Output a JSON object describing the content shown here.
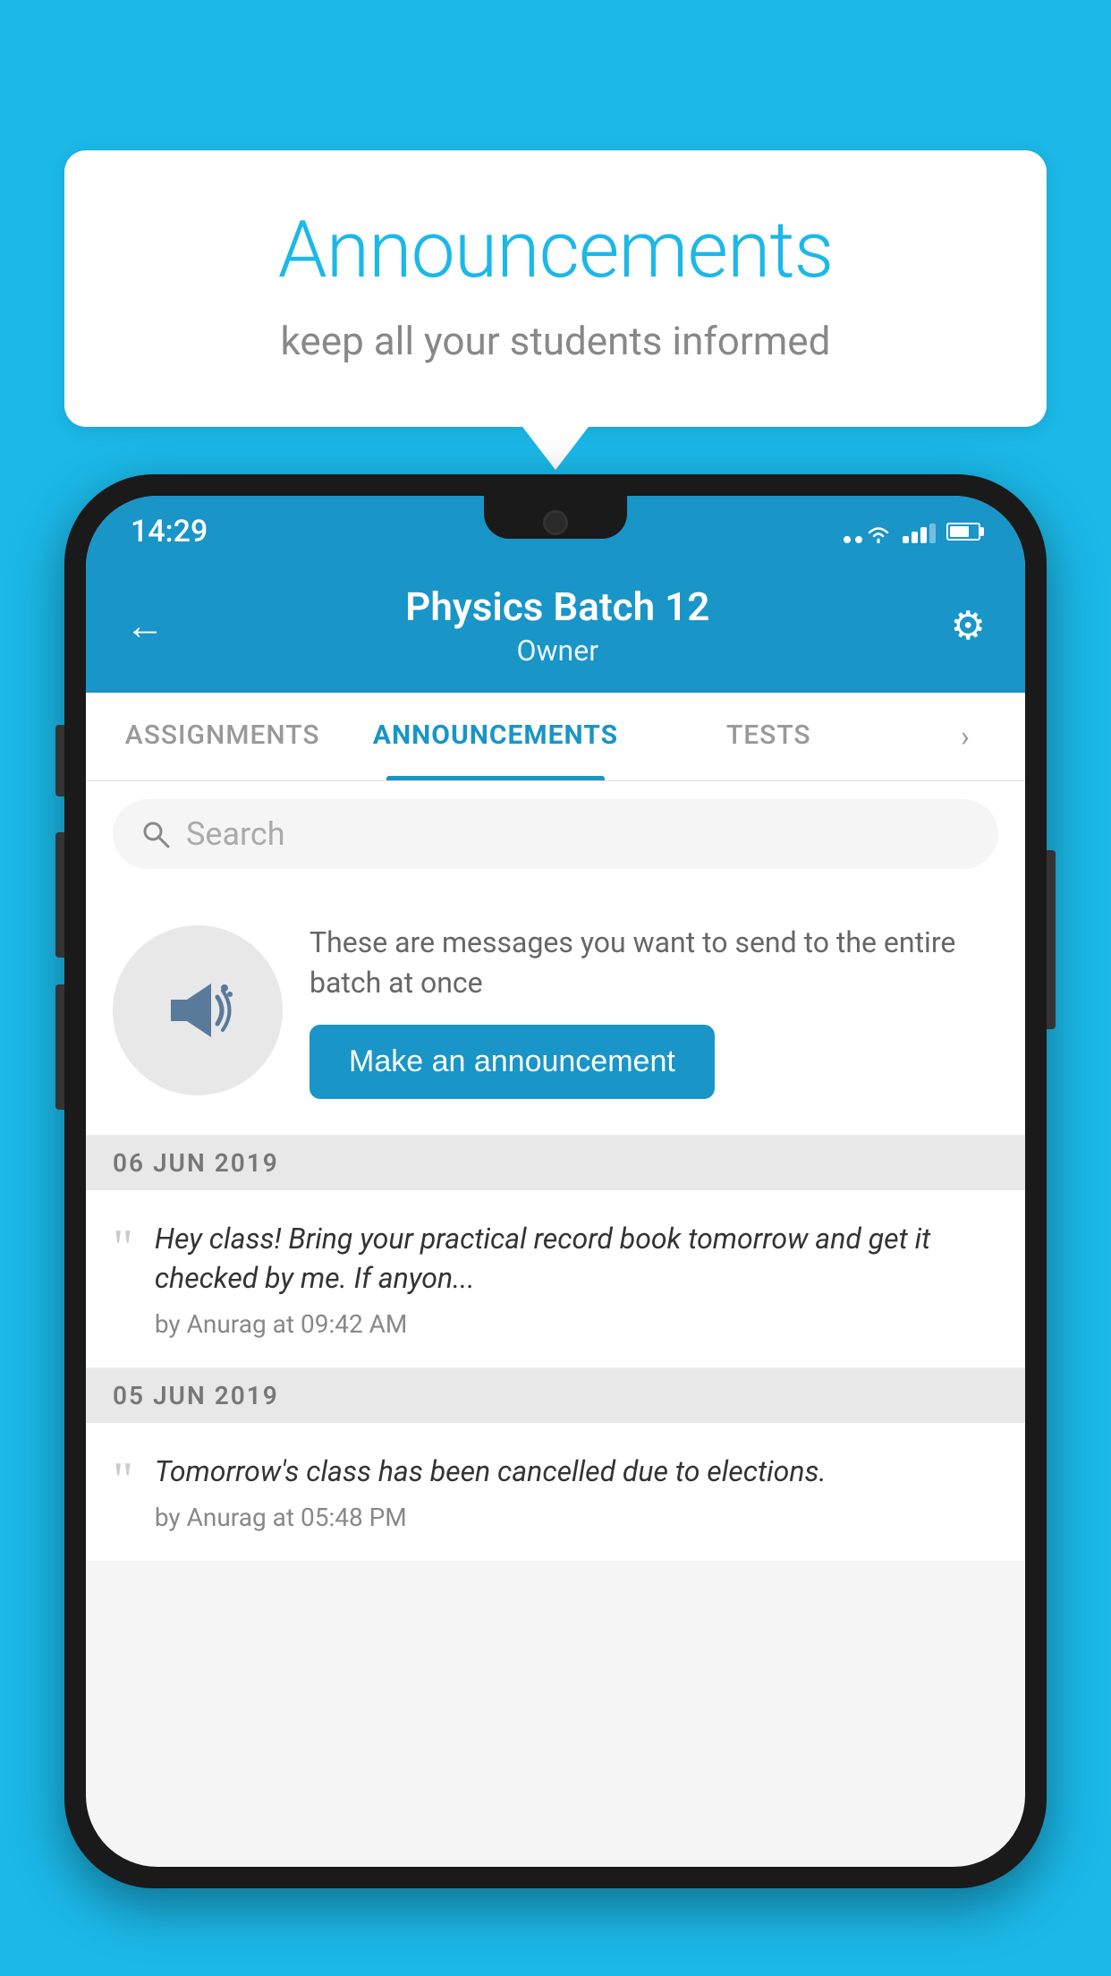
{
  "page": {
    "background_color": "#1bb8e8"
  },
  "speech_bubble": {
    "title": "Announcements",
    "subtitle": "keep all your students informed"
  },
  "status_bar": {
    "time": "14:29"
  },
  "header": {
    "title": "Physics Batch 12",
    "subtitle": "Owner",
    "back_label": "←"
  },
  "tabs": [
    {
      "label": "ASSIGNMENTS",
      "active": false
    },
    {
      "label": "ANNOUNCEMENTS",
      "active": true
    },
    {
      "label": "TESTS",
      "active": false
    }
  ],
  "search": {
    "placeholder": "Search"
  },
  "promo": {
    "text": "These are messages you want to send to the entire batch at once",
    "button_label": "Make an announcement"
  },
  "announcements": [
    {
      "date": "06  JUN  2019",
      "text": "Hey class! Bring your practical record book tomorrow and get it checked by me. If anyon...",
      "meta": "by Anurag at 09:42 AM"
    },
    {
      "date": "05  JUN  2019",
      "text": "Tomorrow's class has been cancelled due to elections.",
      "meta": "by Anurag at 05:48 PM"
    }
  ]
}
